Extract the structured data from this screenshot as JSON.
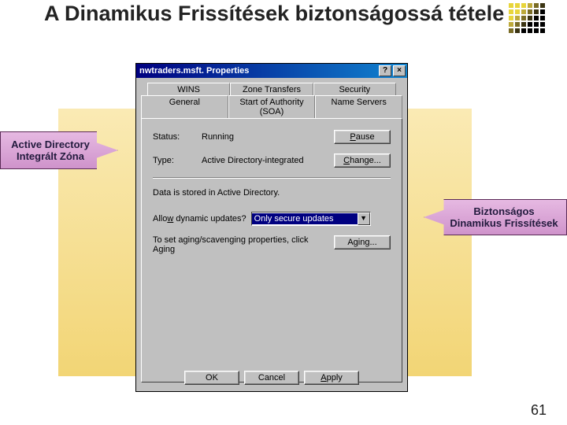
{
  "slide": {
    "title": "A Dinamikus Frissítések biztonságossá tétele",
    "page_number": "61"
  },
  "callouts": {
    "left": "Active Directory Integrált Zóna",
    "right": "Biztonságos Dinamikus Frissítések"
  },
  "dialog": {
    "title": "nwtraders.msft. Properties",
    "help_btn": "?",
    "close_btn": "×",
    "tabs_back": [
      "WINS",
      "Zone Transfers",
      "Security"
    ],
    "tabs_front": [
      "General",
      "Start of Authority (SOA)",
      "Name Servers"
    ],
    "status_label": "Status:",
    "status_value": "Running",
    "pause_btn": "Pause",
    "type_label": "Type:",
    "type_value": "Active Directory-integrated",
    "change_btn": "Change...",
    "ad_note": "Data is stored in Active Directory.",
    "allow_label": "Allow dynamic updates?",
    "allow_selected": "Only secure updates",
    "aging_text": "To set aging/scavenging properties, click Aging",
    "aging_btn": "Aging...",
    "ok": "OK",
    "cancel": "Cancel",
    "apply": "Apply"
  },
  "deco_colors": [
    "#e8d53b",
    "#e8d53b",
    "#e8d53b",
    "#bda93a",
    "#7a6c26",
    "#3b3413",
    "#e8d53b",
    "#e8d53b",
    "#bda93a",
    "#7a6c26",
    "#3b3413",
    "#000",
    "#e8d53b",
    "#bda93a",
    "#7a6c26",
    "#3b3413",
    "#000",
    "#000",
    "#bda93a",
    "#7a6c26",
    "#3b3413",
    "#000",
    "#000",
    "#000",
    "#7a6c26",
    "#3b3413",
    "#000",
    "#000",
    "#000",
    "#000"
  ]
}
